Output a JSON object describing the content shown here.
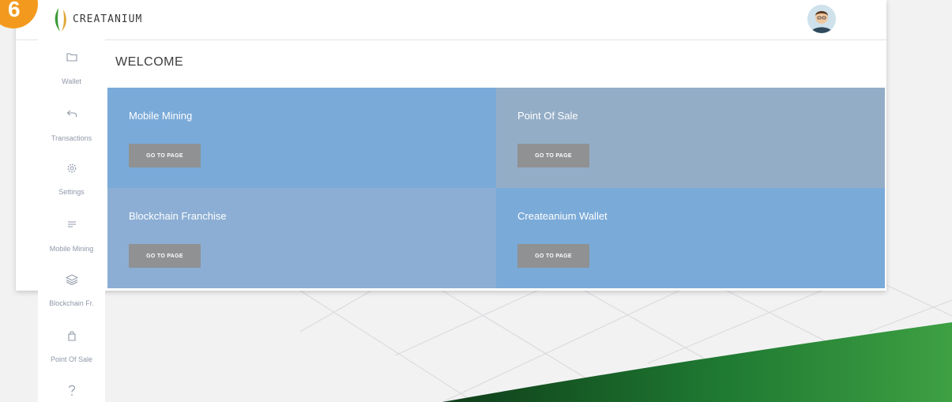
{
  "corner_badge": "6",
  "header": {
    "brand": "CREATANIUM"
  },
  "main": {
    "welcome": "WELCOME"
  },
  "tiles": [
    {
      "title": "Mobile Mining",
      "button": "GO TO PAGE"
    },
    {
      "title": "Point Of Sale",
      "button": "GO TO PAGE"
    },
    {
      "title": "Blockchain Franchise",
      "button": "GO TO PAGE"
    },
    {
      "title": "Createanium Wallet",
      "button": "GO TO PAGE"
    }
  ],
  "sidebar": {
    "items": [
      {
        "label": "Wallet",
        "icon": "folder-icon"
      },
      {
        "label": "Transactions",
        "icon": "undo-arrow-icon"
      },
      {
        "label": "Settings",
        "icon": "gear-icon"
      },
      {
        "label": "Mobile Mining",
        "icon": "list-icon"
      },
      {
        "label": "Blockchain Fr.",
        "icon": "stack-icon"
      },
      {
        "label": "Point Of Sale",
        "icon": "bag-icon"
      },
      {
        "label": "",
        "icon": "help-icon"
      }
    ]
  },
  "colors": {
    "tile_blue": "#7aaad8",
    "tile_steel": "#8fafd0",
    "button_gray": "#8f9192",
    "active_marker": "#3f7fd0",
    "badge_orange": "#f39a1e",
    "swoosh_green": "#1f7a32"
  }
}
